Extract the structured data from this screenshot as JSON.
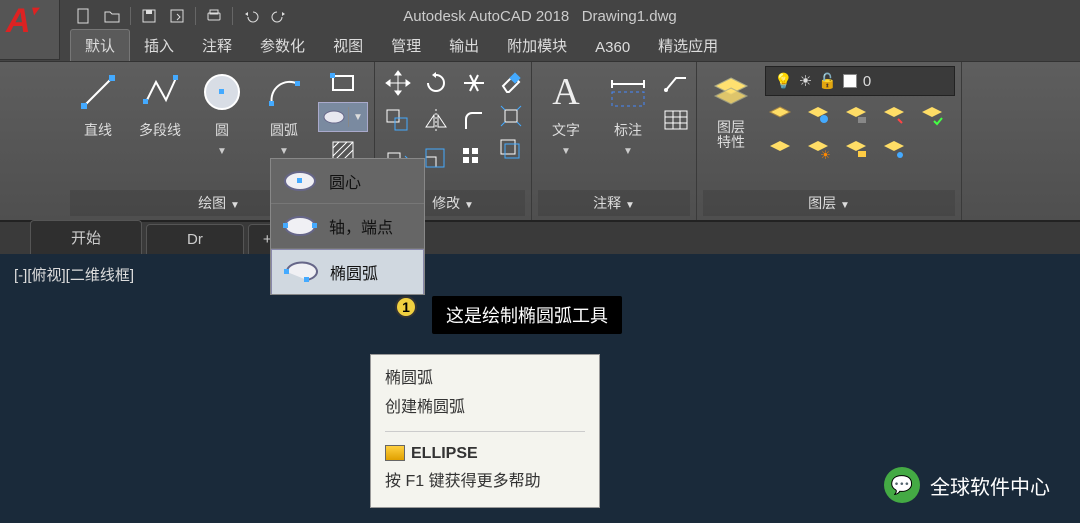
{
  "app": {
    "title_left": "Autodesk AutoCAD 2018",
    "title_right": "Drawing1.dwg",
    "logo_letter": "A"
  },
  "tabs": {
    "t0": "默认",
    "t1": "插入",
    "t2": "注释",
    "t3": "参数化",
    "t4": "视图",
    "t5": "管理",
    "t6": "输出",
    "t7": "附加模块",
    "t8": "A360",
    "t9": "精选应用"
  },
  "draw": {
    "line": "直线",
    "pline": "多段线",
    "circle": "圆",
    "arc": "圆弧",
    "panel": "绘图"
  },
  "modify": {
    "panel": "修改"
  },
  "annot": {
    "text": "文字",
    "dim": "标注",
    "panel": "注释"
  },
  "layers": {
    "props": "图层\n特性",
    "panel": "图层",
    "current": "0"
  },
  "files": {
    "start": "开始",
    "doc": "Dr",
    "plus": "+"
  },
  "viewport": {
    "label": "[-][俯视][二维线框]"
  },
  "flyout": {
    "center": "圆心",
    "axis": "轴，端点",
    "earc": "椭圆弧"
  },
  "badge": {
    "num": "1"
  },
  "anno": {
    "text": "这是绘制椭圆弧工具"
  },
  "tooltip": {
    "title": "椭圆弧",
    "desc": "创建椭圆弧",
    "cmd": "ELLIPSE",
    "help": "按 F1 键获得更多帮助"
  },
  "watermark": {
    "text": "全球软件中心"
  }
}
